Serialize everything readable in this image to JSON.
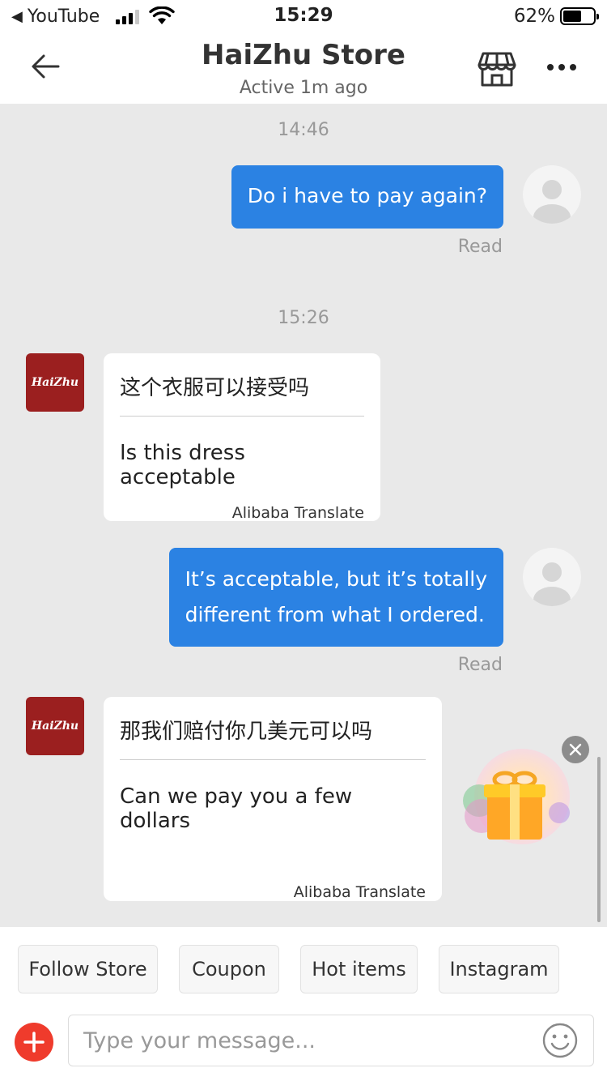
{
  "status_bar": {
    "back_app": "YouTube",
    "time": "15:29",
    "battery_percent": "62%",
    "battery_level": 0.62,
    "signal_bars_active": 3,
    "signal_bars_total": 4
  },
  "header": {
    "title": "HaiZhu Store",
    "subtitle": "Active 1m ago",
    "icons": [
      "back-arrow-icon",
      "store-icon",
      "more-icon"
    ]
  },
  "messages": [
    {
      "type": "timestamp",
      "text": "14:46"
    },
    {
      "type": "outgoing",
      "text": "Do i have to pay again?",
      "status": "Read"
    },
    {
      "type": "timestamp",
      "text": "15:26"
    },
    {
      "type": "incoming",
      "sender_logo": "HaiZhu",
      "original": "这个衣服可以接受吗",
      "translation": "Is this dress acceptable",
      "source": "Alibaba Translate"
    },
    {
      "type": "outgoing",
      "lines": [
        "It’s acceptable, but it’s totally",
        "different from what I ordered."
      ],
      "status": "Read"
    },
    {
      "type": "incoming",
      "sender_logo": "HaiZhu",
      "original": "那我们赔付你几美元可以吗",
      "translation": "Can we pay you a few dollars",
      "source": "Alibaba Translate"
    }
  ],
  "gift_popup": {
    "icon": "gift-icon",
    "close_icon": "close-icon"
  },
  "quick_replies": [
    "Follow Store",
    "Coupon",
    "Hot items",
    "Instagram"
  ],
  "composer": {
    "placeholder": "Type your message...",
    "add_icon": "plus-icon",
    "emoji_icon": "smiley-icon"
  },
  "colors": {
    "outgoing_bubble": "#2b82e3",
    "chat_background": "#e9e9e9",
    "store_avatar": "#9b1f1f",
    "add_button": "#ef3b2c"
  }
}
